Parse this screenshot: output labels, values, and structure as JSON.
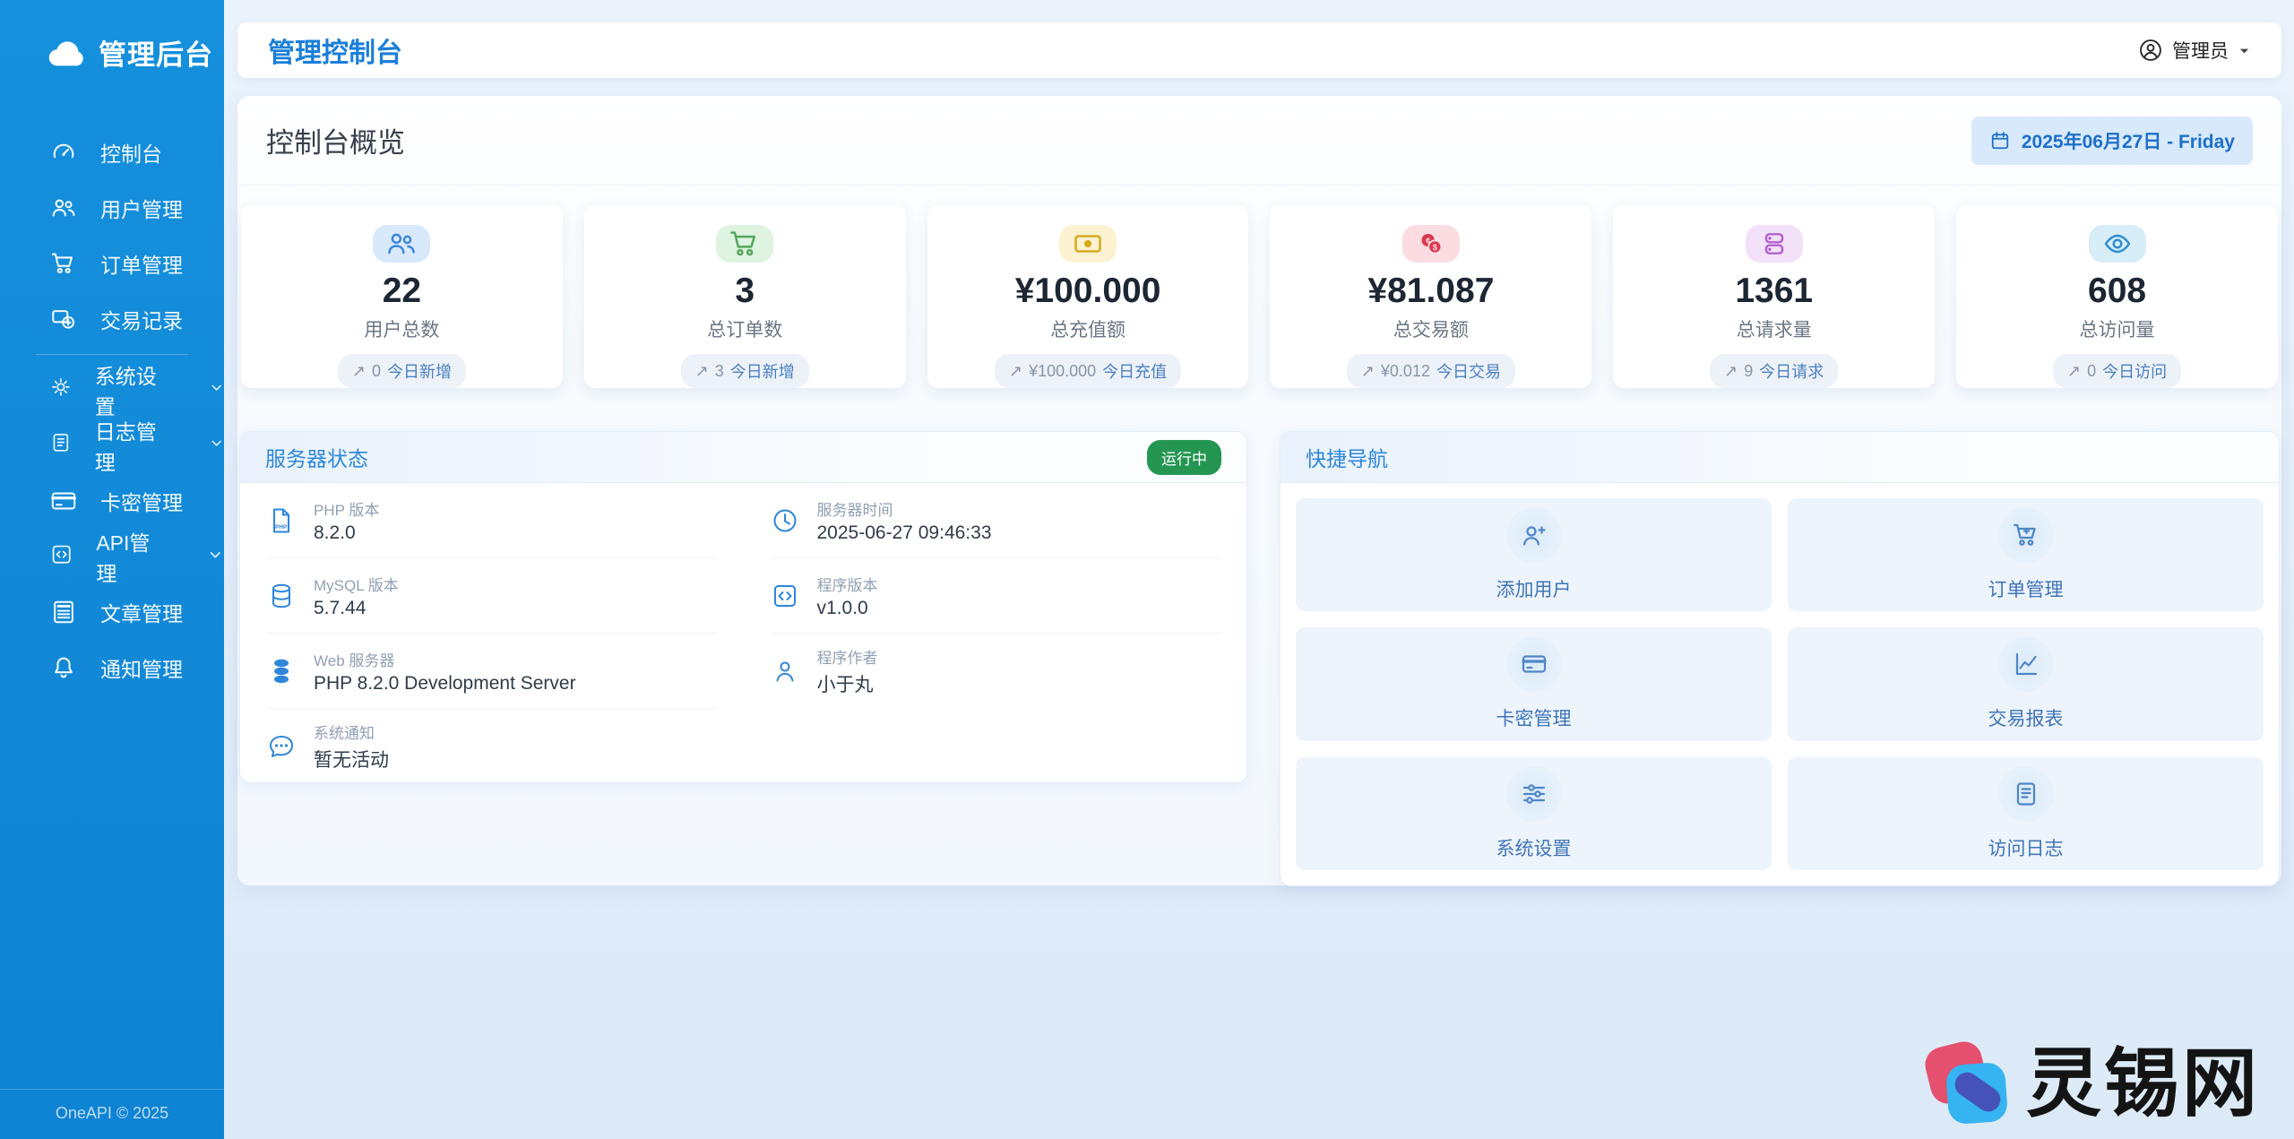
{
  "brand": {
    "name": "管理后台",
    "footer": "OneAPI © 2025"
  },
  "header": {
    "title": "管理控制台",
    "user_label": "管理员"
  },
  "sidebar": {
    "items": [
      {
        "label": "控制台",
        "icon": "dashboard-icon"
      },
      {
        "label": "用户管理",
        "icon": "users-icon"
      },
      {
        "label": "订单管理",
        "icon": "orders-cart-icon"
      },
      {
        "label": "交易记录",
        "icon": "transactions-icon"
      },
      {
        "label": "系统设置",
        "icon": "settings-gear-icon",
        "expandable": true
      },
      {
        "label": "日志管理",
        "icon": "logs-journal-icon",
        "expandable": true
      },
      {
        "label": "卡密管理",
        "icon": "card-keys-icon"
      },
      {
        "label": "API管理",
        "icon": "api-code-icon",
        "expandable": true
      },
      {
        "label": "文章管理",
        "icon": "articles-icon"
      },
      {
        "label": "通知管理",
        "icon": "notifications-bell-icon"
      }
    ]
  },
  "overview": {
    "title": "控制台概览",
    "date_badge": "2025年06月27日 - Friday"
  },
  "stats": {
    "cards": [
      {
        "value": "22",
        "label": "用户总数",
        "badge": {
          "arrow": "↗",
          "count": "0",
          "text": "今日新增"
        },
        "icon": "users-icon",
        "icon_color": "#3a87dd",
        "icon_bg": "#d9e9fc"
      },
      {
        "value": "3",
        "label": "总订单数",
        "badge": {
          "arrow": "↗",
          "count": "3",
          "text": "今日新增"
        },
        "icon": "cart-icon",
        "icon_color": "#55a75c",
        "icon_bg": "#def3e0"
      },
      {
        "value": "¥100.000",
        "label": "总充值额",
        "badge": {
          "arrow": "↗",
          "count": "¥100.000",
          "text": "今日充值"
        },
        "icon": "cash-icon",
        "icon_color": "#d9a616",
        "icon_bg": "#fcf2d2"
      },
      {
        "value": "¥81.087",
        "label": "总交易额",
        "badge": {
          "arrow": "↗",
          "count": "¥0.012",
          "text": "今日交易"
        },
        "icon": "coins-icon",
        "icon_color": "#d93a4e",
        "icon_bg": "#fbdde1"
      },
      {
        "value": "1361",
        "label": "总请求量",
        "badge": {
          "arrow": "↗",
          "count": "9",
          "text": "今日请求"
        },
        "icon": "server-stack-icon",
        "icon_color": "#b35fcd",
        "icon_bg": "#f2e1f8"
      },
      {
        "value": "608",
        "label": "总访问量",
        "badge": {
          "arrow": "↗",
          "count": "0",
          "text": "今日访问"
        },
        "icon": "eye-icon",
        "icon_color": "#2f8fd1",
        "icon_bg": "#d7edf8"
      }
    ]
  },
  "server_status": {
    "title": "服务器状态",
    "status_badge": "运行中",
    "status_color": "#259652",
    "left_rows": [
      {
        "label": "PHP 版本",
        "value": "8.2.0",
        "icon": "php-file-icon"
      },
      {
        "label": "MySQL 版本",
        "value": "5.7.44",
        "icon": "database-icon"
      },
      {
        "label": "Web 服务器",
        "value": "PHP 8.2.0 Development Server",
        "icon": "server-db-icon"
      },
      {
        "label": "系统通知",
        "value": "暂无活动",
        "icon": "chat-dots-icon"
      }
    ],
    "right_rows": [
      {
        "label": "服务器时间",
        "value": "2025-06-27 09:46:33",
        "icon": "clock-icon"
      },
      {
        "label": "程序版本",
        "value": "v1.0.0",
        "icon": "code-square-icon"
      },
      {
        "label": "程序作者",
        "value": "小于丸",
        "icon": "person-icon"
      }
    ]
  },
  "quick_nav": {
    "title": "快捷导航",
    "items": [
      {
        "label": "添加用户",
        "icon": "person-plus-icon"
      },
      {
        "label": "订单管理",
        "icon": "cart-plus-icon"
      },
      {
        "label": "卡密管理",
        "icon": "credit-card-icon"
      },
      {
        "label": "交易报表",
        "icon": "graph-up-icon"
      },
      {
        "label": "系统设置",
        "icon": "sliders-icon"
      },
      {
        "label": "访问日志",
        "icon": "journal-text-icon"
      }
    ]
  },
  "watermark": {
    "text": "灵锡网"
  },
  "colors": {
    "sidebar": "#1187d8",
    "accent": "#1b7fd9",
    "panel_title": "#2e86d9",
    "date_badge_bg": "#d8e9fb",
    "run_badge": "#259652"
  }
}
